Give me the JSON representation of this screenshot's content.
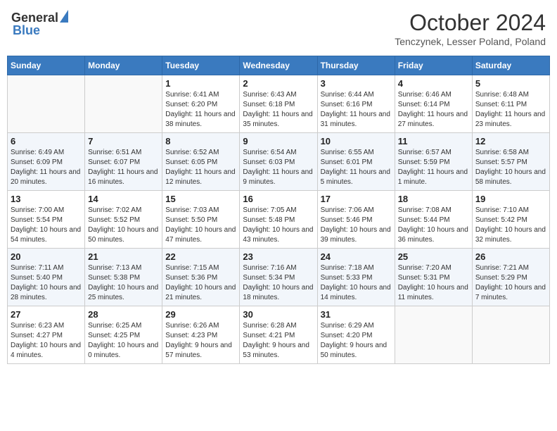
{
  "header": {
    "logo_general": "General",
    "logo_blue": "Blue",
    "month_year": "October 2024",
    "location": "Tenczynek, Lesser Poland, Poland"
  },
  "days_of_week": [
    "Sunday",
    "Monday",
    "Tuesday",
    "Wednesday",
    "Thursday",
    "Friday",
    "Saturday"
  ],
  "weeks": [
    [
      {
        "day": "",
        "info": ""
      },
      {
        "day": "",
        "info": ""
      },
      {
        "day": "1",
        "info": "Sunrise: 6:41 AM\nSunset: 6:20 PM\nDaylight: 11 hours and 38 minutes."
      },
      {
        "day": "2",
        "info": "Sunrise: 6:43 AM\nSunset: 6:18 PM\nDaylight: 11 hours and 35 minutes."
      },
      {
        "day": "3",
        "info": "Sunrise: 6:44 AM\nSunset: 6:16 PM\nDaylight: 11 hours and 31 minutes."
      },
      {
        "day": "4",
        "info": "Sunrise: 6:46 AM\nSunset: 6:14 PM\nDaylight: 11 hours and 27 minutes."
      },
      {
        "day": "5",
        "info": "Sunrise: 6:48 AM\nSunset: 6:11 PM\nDaylight: 11 hours and 23 minutes."
      }
    ],
    [
      {
        "day": "6",
        "info": "Sunrise: 6:49 AM\nSunset: 6:09 PM\nDaylight: 11 hours and 20 minutes."
      },
      {
        "day": "7",
        "info": "Sunrise: 6:51 AM\nSunset: 6:07 PM\nDaylight: 11 hours and 16 minutes."
      },
      {
        "day": "8",
        "info": "Sunrise: 6:52 AM\nSunset: 6:05 PM\nDaylight: 11 hours and 12 minutes."
      },
      {
        "day": "9",
        "info": "Sunrise: 6:54 AM\nSunset: 6:03 PM\nDaylight: 11 hours and 9 minutes."
      },
      {
        "day": "10",
        "info": "Sunrise: 6:55 AM\nSunset: 6:01 PM\nDaylight: 11 hours and 5 minutes."
      },
      {
        "day": "11",
        "info": "Sunrise: 6:57 AM\nSunset: 5:59 PM\nDaylight: 11 hours and 1 minute."
      },
      {
        "day": "12",
        "info": "Sunrise: 6:58 AM\nSunset: 5:57 PM\nDaylight: 10 hours and 58 minutes."
      }
    ],
    [
      {
        "day": "13",
        "info": "Sunrise: 7:00 AM\nSunset: 5:54 PM\nDaylight: 10 hours and 54 minutes."
      },
      {
        "day": "14",
        "info": "Sunrise: 7:02 AM\nSunset: 5:52 PM\nDaylight: 10 hours and 50 minutes."
      },
      {
        "day": "15",
        "info": "Sunrise: 7:03 AM\nSunset: 5:50 PM\nDaylight: 10 hours and 47 minutes."
      },
      {
        "day": "16",
        "info": "Sunrise: 7:05 AM\nSunset: 5:48 PM\nDaylight: 10 hours and 43 minutes."
      },
      {
        "day": "17",
        "info": "Sunrise: 7:06 AM\nSunset: 5:46 PM\nDaylight: 10 hours and 39 minutes."
      },
      {
        "day": "18",
        "info": "Sunrise: 7:08 AM\nSunset: 5:44 PM\nDaylight: 10 hours and 36 minutes."
      },
      {
        "day": "19",
        "info": "Sunrise: 7:10 AM\nSunset: 5:42 PM\nDaylight: 10 hours and 32 minutes."
      }
    ],
    [
      {
        "day": "20",
        "info": "Sunrise: 7:11 AM\nSunset: 5:40 PM\nDaylight: 10 hours and 28 minutes."
      },
      {
        "day": "21",
        "info": "Sunrise: 7:13 AM\nSunset: 5:38 PM\nDaylight: 10 hours and 25 minutes."
      },
      {
        "day": "22",
        "info": "Sunrise: 7:15 AM\nSunset: 5:36 PM\nDaylight: 10 hours and 21 minutes."
      },
      {
        "day": "23",
        "info": "Sunrise: 7:16 AM\nSunset: 5:34 PM\nDaylight: 10 hours and 18 minutes."
      },
      {
        "day": "24",
        "info": "Sunrise: 7:18 AM\nSunset: 5:33 PM\nDaylight: 10 hours and 14 minutes."
      },
      {
        "day": "25",
        "info": "Sunrise: 7:20 AM\nSunset: 5:31 PM\nDaylight: 10 hours and 11 minutes."
      },
      {
        "day": "26",
        "info": "Sunrise: 7:21 AM\nSunset: 5:29 PM\nDaylight: 10 hours and 7 minutes."
      }
    ],
    [
      {
        "day": "27",
        "info": "Sunrise: 6:23 AM\nSunset: 4:27 PM\nDaylight: 10 hours and 4 minutes."
      },
      {
        "day": "28",
        "info": "Sunrise: 6:25 AM\nSunset: 4:25 PM\nDaylight: 10 hours and 0 minutes."
      },
      {
        "day": "29",
        "info": "Sunrise: 6:26 AM\nSunset: 4:23 PM\nDaylight: 9 hours and 57 minutes."
      },
      {
        "day": "30",
        "info": "Sunrise: 6:28 AM\nSunset: 4:21 PM\nDaylight: 9 hours and 53 minutes."
      },
      {
        "day": "31",
        "info": "Sunrise: 6:29 AM\nSunset: 4:20 PM\nDaylight: 9 hours and 50 minutes."
      },
      {
        "day": "",
        "info": ""
      },
      {
        "day": "",
        "info": ""
      }
    ]
  ]
}
